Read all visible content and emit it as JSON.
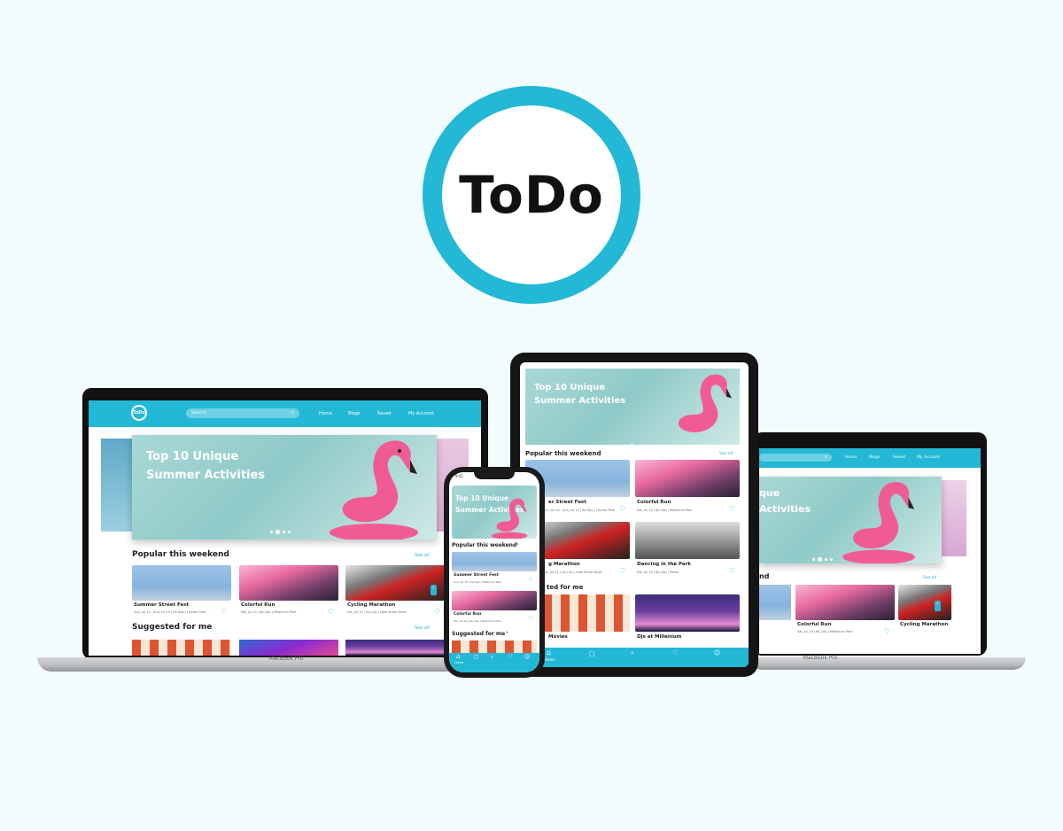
{
  "brand": {
    "logo_text": "ToDo",
    "mini_logo": "ToDo",
    "accent": "#23b8d6"
  },
  "nav": {
    "search_placeholder": "Search",
    "links": [
      "Home",
      "Blogs",
      "Saved",
      "My Account"
    ]
  },
  "hero": {
    "line1": "Top 10 Unique",
    "line2": "Summer Activities"
  },
  "popular": {
    "title": "Popular this weekend",
    "see_all": "See all"
  },
  "suggested": {
    "title": "Suggested for me",
    "see_all": "See all"
  },
  "events": [
    {
      "title": "Summer Street Fest",
      "meta": "Sun, Jul 14 - Sun, Jul 15 | All Day | Lincoln Park",
      "image": "street"
    },
    {
      "title": "Colorful Run",
      "meta": "Sat, Jul 10 | 6p-10p | Millenium Park",
      "image": "color"
    },
    {
      "title": "Cycling Marathon",
      "meta": "Sat, Jul 11 | 5a-12p | Lake Shore Drive",
      "image": "cycling"
    },
    {
      "title": "Dancing in the Park",
      "meta": "Sat, Jul 10 | 6p-10p | Pilsen",
      "image": "dance"
    },
    {
      "title": "Outdoor Movies",
      "meta": "",
      "image": "movies"
    },
    {
      "title": "DJs at Millenium",
      "meta": "",
      "image": "dj"
    }
  ],
  "tablet_labels": {
    "c1": "er Street Fest",
    "c1meta": "Sun, Jul 14 - Sun, Jul 15 | All Day | Lincoln Park",
    "c3": "g Marathon",
    "c3meta": "Sat, Jul 11 | 5a-12p | Lake Shore Drive",
    "suggested": "ted for me",
    "c5": "Movies"
  },
  "laptop2_labels": {
    "hero1": "que",
    "hero2": "Activities",
    "popular": "nd",
    "cyc": "Cycling Marathon"
  },
  "phone": {
    "time": "9:41",
    "bottom_home": "Home",
    "c2meta": "Sun, Jul 10 | 6p-10p | Millenium Park"
  },
  "tablet_bottom": {
    "home": "Home"
  },
  "device_label": "MacBook Pro"
}
